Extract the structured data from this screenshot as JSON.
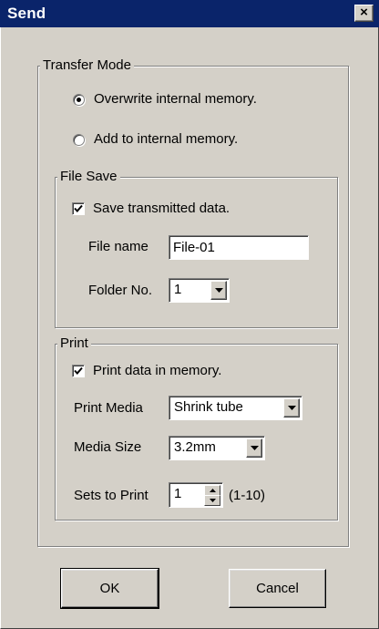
{
  "window": {
    "title": "Send",
    "close_glyph": "×"
  },
  "transfer_mode": {
    "legend": "Transfer Mode",
    "options": [
      {
        "label": "Overwrite internal memory.",
        "selected": true
      },
      {
        "label": "Add to internal memory.",
        "selected": false
      }
    ]
  },
  "file_save": {
    "legend": "File Save",
    "save_checkbox": {
      "label": "Save transmitted data.",
      "checked": true
    },
    "file_name": {
      "label": "File name",
      "value": "File-01"
    },
    "folder_no": {
      "label": "Folder No.",
      "value": "1"
    }
  },
  "print": {
    "legend": "Print",
    "print_checkbox": {
      "label": "Print data in memory.",
      "checked": true
    },
    "print_media": {
      "label": "Print Media",
      "value": "Shrink tube"
    },
    "media_size": {
      "label": "Media Size",
      "value": "3.2mm"
    },
    "sets_to_print": {
      "label": "Sets to Print",
      "value": "1",
      "range_hint": "(1-10)"
    }
  },
  "buttons": {
    "ok": "OK",
    "cancel": "Cancel"
  },
  "icons": [
    "close-icon",
    "radio-dot-icon",
    "checkmark-icon",
    "dropdown-arrow-icon",
    "spin-up-icon",
    "spin-down-icon"
  ]
}
